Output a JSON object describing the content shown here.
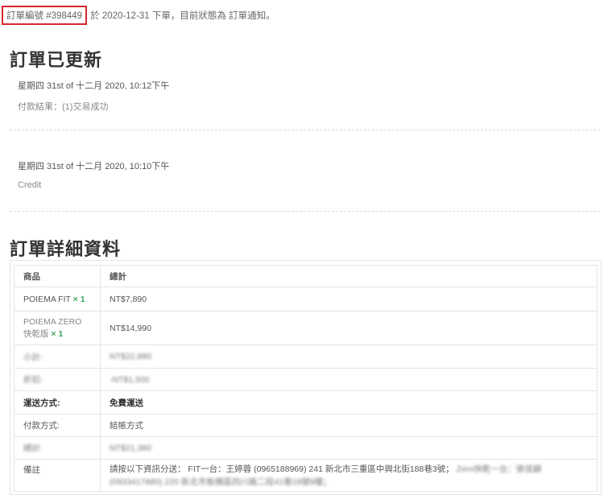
{
  "notice": {
    "order_label": "訂單編號 #398449",
    "rest": " 於 2020-12-31 下單，目前狀態為 訂單通知。"
  },
  "updates": {
    "heading": "訂單已更新",
    "notes": [
      {
        "meta": "星期四 31st of 十二月 2020, 10:12下午",
        "desc": "付款結果：(1)交易成功"
      },
      {
        "meta": "星期四 31st of 十二月 2020, 10:10下午",
        "desc": "Credit"
      }
    ]
  },
  "details": {
    "heading": "訂單詳細資料",
    "col_product": "商品",
    "col_total": "總計",
    "items": [
      {
        "name": "POIEMA FIT",
        "qty": "× 1",
        "total": "NT$7,890"
      },
      {
        "name": "POIEMA ZERO 快乾版",
        "qty": "× 1",
        "total": "NT$14,990"
      }
    ],
    "blurred1_label": "小計:",
    "blurred1_value": "NT$22,880",
    "blurred2_label": "折扣:",
    "blurred2_value": "-NT$1,500",
    "shipping_label": "運送方式:",
    "shipping_value": "免費運送",
    "payment_label": "付款方式:",
    "payment_value": "結帳方式",
    "total_label": "總計:",
    "total_value": "NT$21,380",
    "note_label": "備註",
    "note_value_clear": "請按以下資訊分送： FIT一台：王婷蓉 (0965188969) 241 新北市三重區中興北街188巷3號；",
    "note_value_blur": " Zero快乾一台：張佳穎 (0933417880) 220 新北市板橋區四川路二段41巷18號8樓；"
  }
}
